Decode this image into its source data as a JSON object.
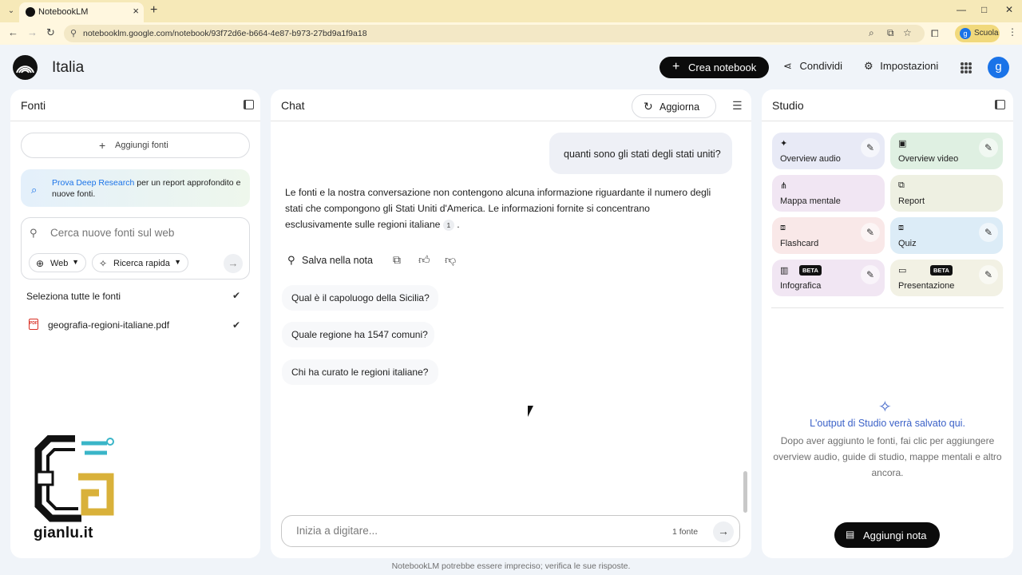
{
  "browser": {
    "tab_title": "NotebookLM",
    "url": "notebooklm.google.com/notebook/93f72d6e-b664-4e87-b973-27bd9a1f9a18",
    "profile_initial": "g",
    "profile_name": "Scuola"
  },
  "header": {
    "notebook_title": "Italia",
    "create_label": "Crea notebook",
    "share_label": "Condividi",
    "settings_label": "Impostazioni",
    "avatar_initial": "g"
  },
  "sources": {
    "title": "Fonti",
    "add_label": "Aggiungi fonti",
    "deep_research_link": "Prova Deep Research",
    "deep_research_text": " per un report approfondito e nuove fonti.",
    "search_placeholder": "Cerca nuove fonti sul web",
    "chip_web": "Web",
    "chip_mode": "Ricerca rapida",
    "select_all_label": "Seleziona tutte le fonti",
    "items": [
      {
        "name": "geografia-regioni-italiane.pdf",
        "checked": true
      }
    ]
  },
  "chat": {
    "title": "Chat",
    "refresh_label": "Aggiorna",
    "user_message": "quanti sono gli stati degli stati uniti?",
    "answer_text": "Le fonti e la nostra conversazione non contengono alcuna informazione riguardante il numero degli stati che compongono gli Stati Uniti d'America. Le informazioni fornite si concentrano esclusivamente sulle regioni italiane",
    "answer_citation": "1",
    "answer_end": ".",
    "save_note_label": "Salva nella nota",
    "suggestions": [
      "Qual è il capoluogo della Sicilia?",
      "Quale regione ha 1547 comuni?",
      "Chi ha curato le regioni italiane?"
    ],
    "input_placeholder": "Inizia a digitare...",
    "source_count": "1 fonte"
  },
  "studio": {
    "title": "Studio",
    "tiles": [
      {
        "label": "Overview audio",
        "color": "#e8eaf6",
        "beta": false,
        "editable": true
      },
      {
        "label": "Overview video",
        "color": "#dff0e2",
        "beta": false,
        "editable": true
      },
      {
        "label": "Mappa mentale",
        "color": "#f1e6f3",
        "beta": false,
        "editable": false
      },
      {
        "label": "Report",
        "color": "#eef0e2",
        "beta": false,
        "editable": false
      },
      {
        "label": "Flashcard",
        "color": "#f9e8e8",
        "beta": false,
        "editable": true
      },
      {
        "label": "Quiz",
        "color": "#dcecf7",
        "beta": false,
        "editable": true
      },
      {
        "label": "Infografica",
        "color": "#f1e6f3",
        "beta": true,
        "editable": true
      },
      {
        "label": "Presentazione",
        "color": "#f2f1e4",
        "beta": true,
        "editable": true
      }
    ],
    "beta_label": "BETA",
    "empty_title": "L'output di Studio verrà salvato qui.",
    "empty_desc": "Dopo aver aggiunto le fonti, fai clic per aggiungere overview audio, guide di studio, mappe mentali e altro ancora.",
    "add_note_label": "Aggiungi nota"
  },
  "footer": {
    "disclaimer": "NotebookLM potrebbe essere impreciso; verifica le sue risposte."
  },
  "watermark": {
    "text": "gianlu.it"
  }
}
